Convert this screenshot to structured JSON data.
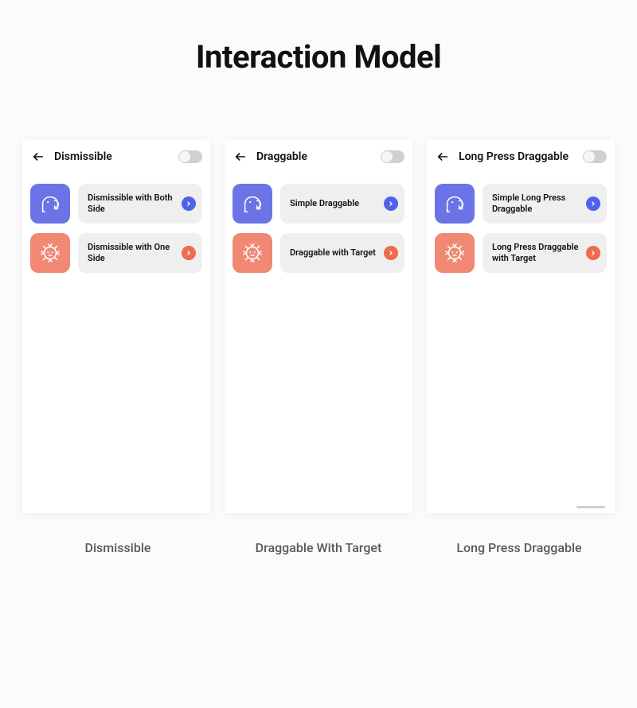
{
  "title": "Interaction Model",
  "panes": [
    {
      "header": "Dismissible",
      "caption": "Dismissible",
      "items": [
        {
          "label": "Dismissible with Both Side",
          "tile_color": "indigo",
          "chev_color": "blue",
          "icon": "elephant"
        },
        {
          "label": "Dismissible with One Side",
          "tile_color": "coral",
          "chev_color": "orange",
          "icon": "lion"
        }
      ]
    },
    {
      "header": "Draggable",
      "caption": "Draggable With Target",
      "items": [
        {
          "label": "Simple Draggable",
          "tile_color": "indigo",
          "chev_color": "blue",
          "icon": "elephant"
        },
        {
          "label": "Draggable with Target",
          "tile_color": "coral",
          "chev_color": "orange",
          "icon": "lion"
        }
      ]
    },
    {
      "header": "Long Press Draggable",
      "caption": "Long Press Draggable",
      "items": [
        {
          "label": "Simple Long Press Draggable",
          "tile_color": "indigo",
          "chev_color": "blue",
          "icon": "elephant"
        },
        {
          "label": "Long Press Draggable with Target",
          "tile_color": "coral",
          "chev_color": "orange",
          "icon": "lion"
        }
      ]
    }
  ],
  "colors": {
    "indigo": "#6b74e6",
    "coral": "#f08873",
    "blue_accent": "#4e63e9",
    "orange_accent": "#ee6b4e"
  }
}
